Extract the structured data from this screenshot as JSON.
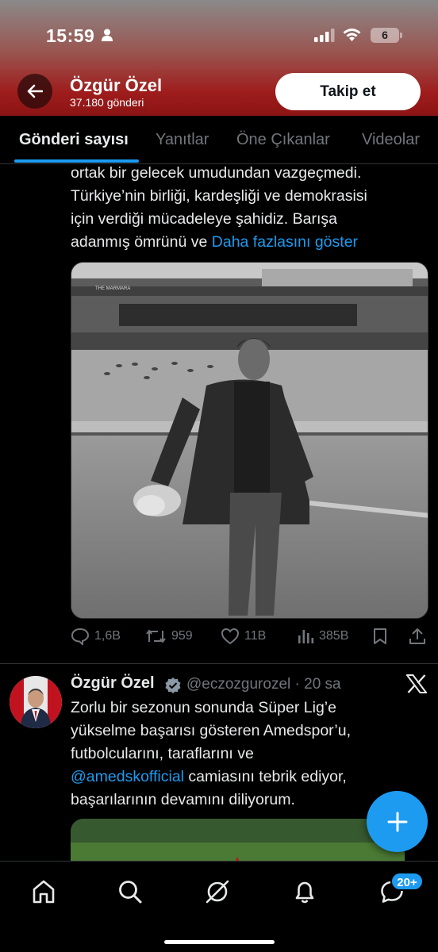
{
  "status_bar": {
    "time": "15:59",
    "battery": "6"
  },
  "profile": {
    "name": "Özgür Özel",
    "post_count": "37.180 gönderi",
    "follow_label": "Takip et"
  },
  "tabs": [
    {
      "label": "Gönderi sayısı",
      "active": true
    },
    {
      "label": "Yanıtlar",
      "active": false
    },
    {
      "label": "Öne Çıkanlar",
      "active": false
    },
    {
      "label": "Videolar",
      "active": false
    }
  ],
  "post1": {
    "lines": [
      "ortak bir gelecek umudundan vazgeçmedi.",
      "Türkiye’nin birliği, kardeşliği ve demokrasisi",
      "için verdiği mücadeleye şahidiz. Barışa",
      "adanmış ömrünü ve "
    ],
    "show_more": "Daha fazlasını göster",
    "photo_sign": "THE MARMARA",
    "stats": {
      "replies": "1,6B",
      "reposts": "959",
      "likes": "11B",
      "views": "385B"
    }
  },
  "post2": {
    "author": "Özgür Özel",
    "handle_time": "@eczozgurozel · 20 sa",
    "line1": "Zorlu bir sezonun sonunda Süper Lig’e",
    "line2": "yükselme başarısı gösteren Amedspor’u,",
    "line3": "futbolcularını, taraflarını ve",
    "mention": "@amedskofficial",
    "line4_rest": " camiasını tebrik ediyor,",
    "line5": "başarılarının devamını diliyorum."
  },
  "bottom_nav": {
    "messages_badge": "20+"
  },
  "colors": {
    "accent": "#1d9bf0",
    "header_red": "#9e1c1c",
    "background": "#000000"
  }
}
